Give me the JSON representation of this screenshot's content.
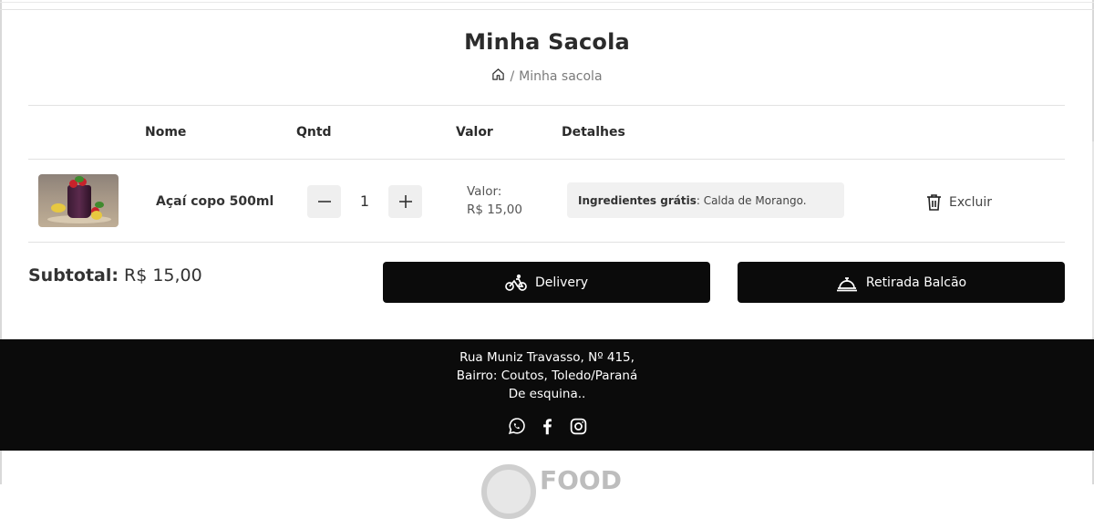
{
  "page": {
    "title": "Minha Sacola",
    "breadcrumb": {
      "home_icon": "home-icon",
      "separator": "/",
      "current": "Minha sacola"
    }
  },
  "table": {
    "headers": {
      "name": "Nome",
      "qty": "Qntd",
      "value": "Valor",
      "details": "Detalhes"
    },
    "rows": [
      {
        "image": "acai-cup-photo",
        "name": "Açaí copo 500ml",
        "qty": "1",
        "minus_icon": "minus-icon",
        "plus_icon": "plus-icon",
        "value_label": "Valor:",
        "value": "R$ 15,00",
        "details_label": "Ingredientes grátis",
        "details_value": ": Calda de Morango.",
        "delete_label": "Excluir",
        "delete_icon": "trash-icon"
      }
    ]
  },
  "summary": {
    "subtotal_label": "Subtotal:",
    "subtotal_value": "R$ 15,00",
    "delivery_label": "Delivery",
    "delivery_icon": "bicycle-icon",
    "pickup_label": "Retirada Balcão",
    "pickup_icon": "counter-bell-icon"
  },
  "footer": {
    "address_line1": "Rua Muniz Travasso, Nº 415,",
    "address_line2": "Bairro: Coutos, Toledo/Paraná",
    "address_line3": "De esquina..",
    "social": [
      "whatsapp-icon",
      "facebook-icon",
      "instagram-icon"
    ]
  },
  "logo": {
    "text": "FOOD"
  },
  "colors": {
    "button_bg": "#0b0b0b",
    "footer_bg": "#0b0b0b",
    "detail_bg": "#f1f1f1"
  }
}
